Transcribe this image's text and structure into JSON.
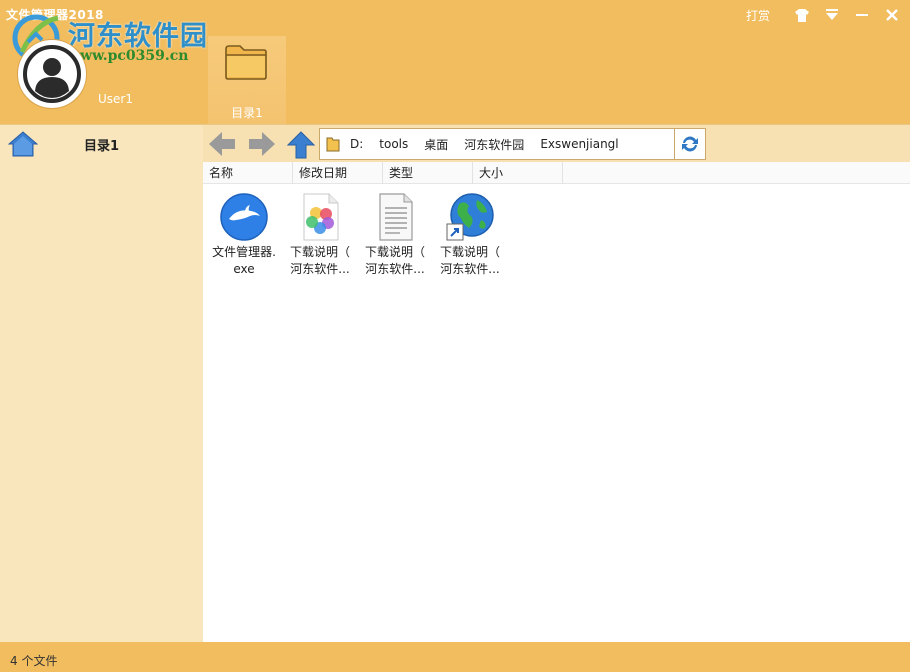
{
  "window": {
    "title": "文件管理器2018",
    "reward_label": "打赏"
  },
  "watermark": {
    "brand": "河东软件园",
    "url": "www.pc0359.cn"
  },
  "user": {
    "name": "User1"
  },
  "tabs": [
    {
      "label": "目录1",
      "icon": "folder-icon"
    }
  ],
  "sidebar": {
    "title": "目录1"
  },
  "path": {
    "segments": [
      "D:",
      "tools",
      "桌面",
      "河东软件园",
      "Exswenjiangl"
    ]
  },
  "columns": [
    "名称",
    "修改日期",
    "类型",
    "大小"
  ],
  "files": [
    {
      "name": "文件管理器.\nexe",
      "icon": "dolphin-app-icon"
    },
    {
      "name": "下载说明（\n河东软件...",
      "icon": "colorful-image-icon"
    },
    {
      "name": "下载说明（\n河东软件...",
      "icon": "text-document-icon"
    },
    {
      "name": "下载说明（\n河东软件...",
      "icon": "globe-shortcut-icon"
    }
  ],
  "status": {
    "text": "4 个文件"
  },
  "colors": {
    "accent": "#f1bd5f",
    "panel": "#f9e6bd",
    "arrow_blue": "#3b7fd1"
  }
}
